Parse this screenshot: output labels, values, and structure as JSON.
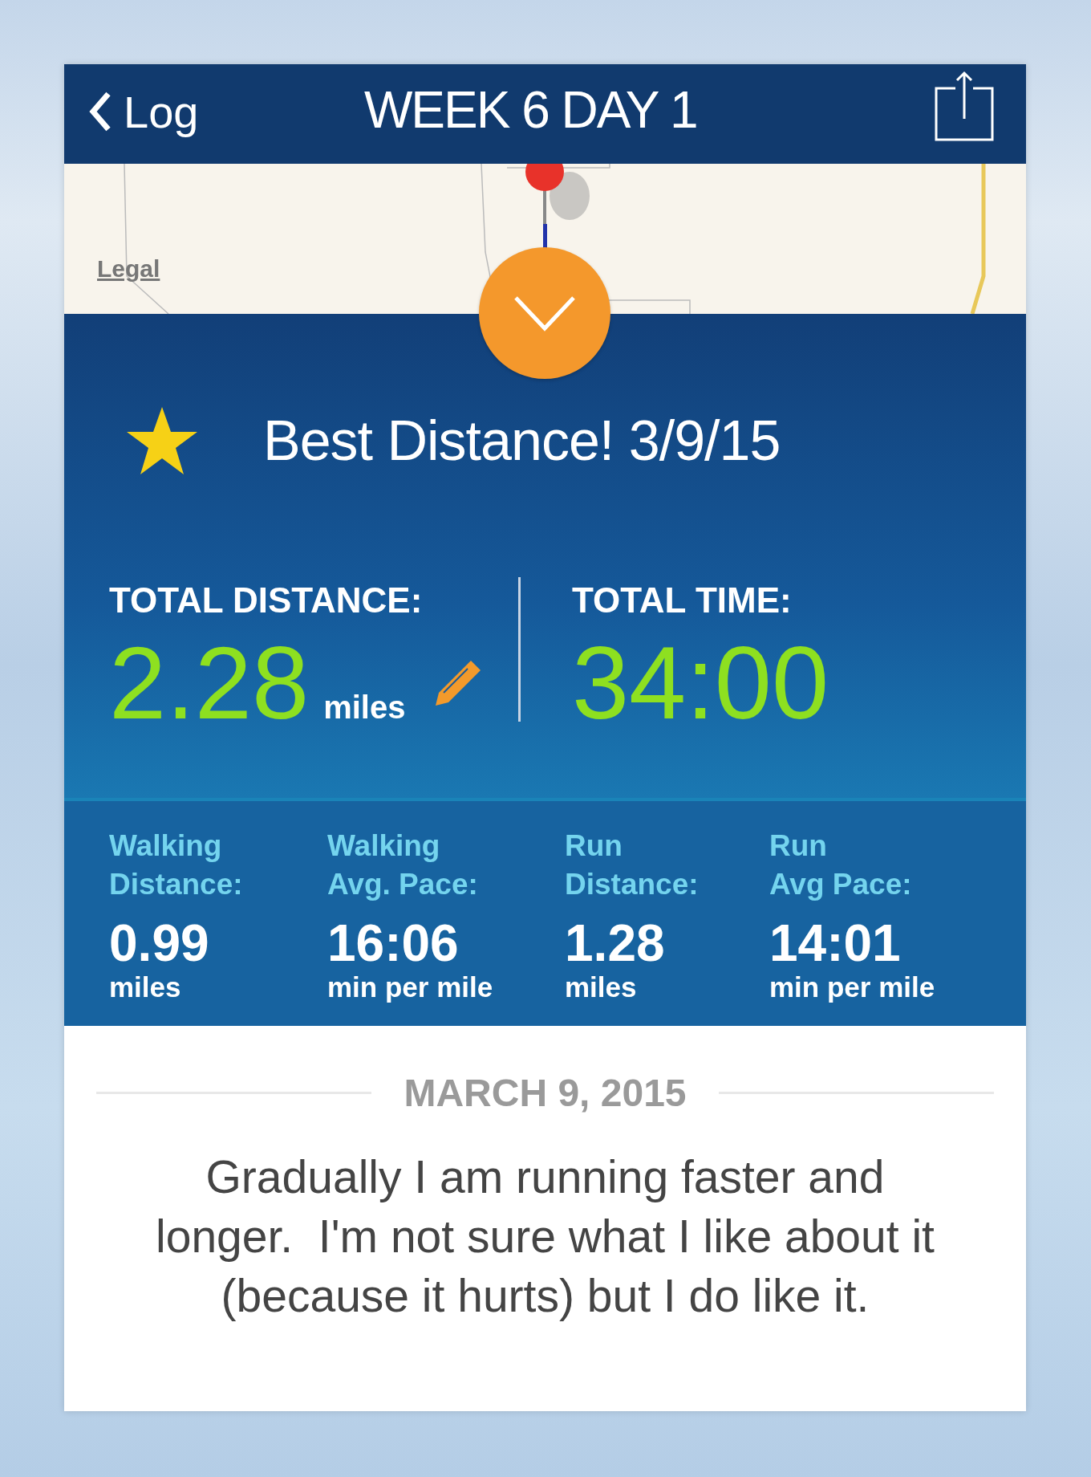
{
  "nav": {
    "back": "Log",
    "title": "WEEK 6 DAY 1"
  },
  "map": {
    "kind": "picture",
    "legal": "Legal"
  },
  "achievement": {
    "text": "Best Distance! 3/9/15"
  },
  "totals": [
    {
      "label": "TOTAL DISTANCE:",
      "value": "2.28",
      "unit": "miles",
      "editable": true
    },
    {
      "label": "TOTAL TIME:",
      "value": "34:00"
    }
  ],
  "stats": [
    {
      "label": [
        "Walking",
        "Distance:"
      ],
      "value": "0.99",
      "unit": "miles"
    },
    {
      "label": [
        "Walking",
        "Avg. Pace:"
      ],
      "value": "16:06",
      "unit": "min per mile"
    },
    {
      "label": [
        "Run",
        "Distance:"
      ],
      "value": "1.28",
      "unit": "miles"
    },
    {
      "label": [
        "Run",
        "Avg Pace:"
      ],
      "value": "14:01",
      "unit": "min per mile"
    }
  ],
  "note": {
    "date": "MARCH 9, 2015",
    "text": "Gradually I am running faster and longer.  I'm not sure what I like about it (because it hurts) but I do like it."
  }
}
